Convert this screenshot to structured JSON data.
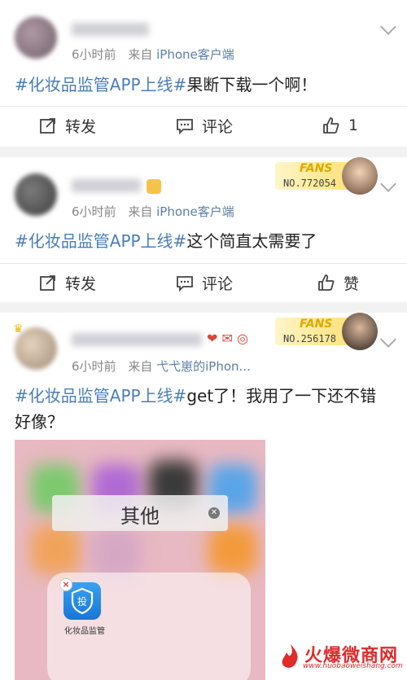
{
  "posts": [
    {
      "meta_time": "6小时前",
      "meta_from": "来自",
      "meta_source": "iPhone客户端",
      "hashtag": "#化妆品监管APP上线#",
      "text": "果断下载一个啊！",
      "actions": {
        "repost": "转发",
        "comment": "评论",
        "like": "1"
      }
    },
    {
      "meta_time": "6小时前",
      "meta_from": "来自",
      "meta_source": "iPhone客户端",
      "hashtag": "#化妆品监管APP上线#",
      "text": "这个简直太需要了",
      "fans_label": "FANS",
      "fans_no": "NO.772054",
      "actions": {
        "repost": "转发",
        "comment": "评论",
        "like": "赞"
      }
    },
    {
      "meta_time": "6小时前",
      "meta_from": "来自",
      "meta_source": "弋弋崽的iPhon...",
      "hashtag": "#化妆品监管APP上线#",
      "text": "get了！我用了一下还不错",
      "text2": "好像？",
      "fans_label": "FANS",
      "fans_no": "NO.256178",
      "image": {
        "folder_title": "其他",
        "app_label": "化妆品监管"
      }
    }
  ],
  "watermark": {
    "text": "火爆微商网",
    "url": "www.huobaoweishang.com"
  },
  "colors": {
    "link": "#4a7db7",
    "meta": "#888888",
    "source": "#5b7ea6",
    "brand_red": "#e02b2b"
  }
}
